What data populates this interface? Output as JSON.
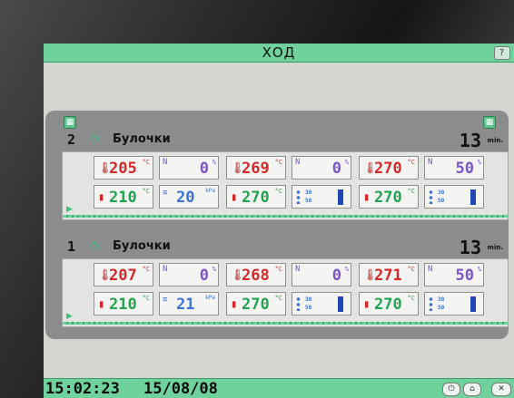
{
  "header": {
    "title": "ХОД",
    "help_label": "?"
  },
  "ovens": [
    {
      "number": "2",
      "name": "Булочки",
      "time": "13",
      "time_unit": "min.",
      "decks": [
        {
          "top_temp": "205",
          "bottom_temp": "210",
          "humidity": "0",
          "pressure": "20"
        },
        {
          "top_temp": "269",
          "bottom_temp": "270",
          "humidity": "0",
          "steam": [
            "30",
            "50"
          ]
        },
        {
          "top_temp": "270",
          "bottom_temp": "270",
          "humidity": "50",
          "steam": [
            "30",
            "50"
          ]
        }
      ]
    },
    {
      "number": "1",
      "name": "Булочки",
      "time": "13",
      "time_unit": "min.",
      "decks": [
        {
          "top_temp": "207",
          "bottom_temp": "210",
          "humidity": "0",
          "pressure": "21"
        },
        {
          "top_temp": "268",
          "bottom_temp": "270",
          "humidity": "0",
          "steam": [
            "30",
            "50"
          ]
        },
        {
          "top_temp": "271",
          "bottom_temp": "270",
          "humidity": "50",
          "steam": [
            "30",
            "50"
          ]
        }
      ]
    }
  ],
  "units": {
    "celsius": "°C",
    "percent": "%",
    "kpa": "kPa"
  },
  "footer": {
    "time": "15:02:23",
    "date": "15/08/08",
    "buttons": [
      "power-icon",
      "home-icon",
      "close-icon"
    ]
  },
  "colors": {
    "bar_green": "#6fd19c",
    "temp_top": "#d22a2a",
    "temp_bottom": "#22a34f",
    "humidity": "#7a55c8",
    "pressure": "#3b73d6"
  }
}
